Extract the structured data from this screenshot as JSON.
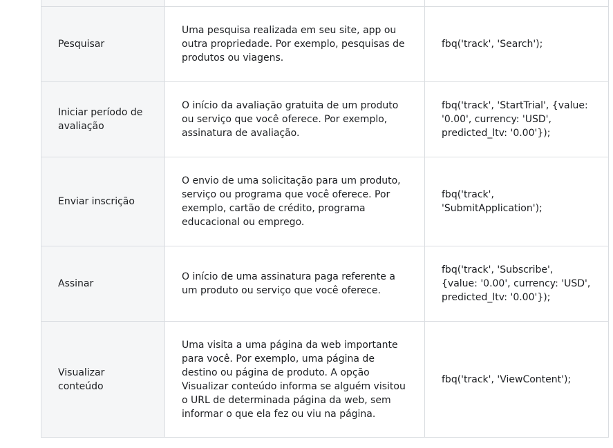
{
  "events": [
    {
      "name": "Pesquisar",
      "description": "Uma pesquisa realizada em seu site, app ou outra propriedade. Por exemplo, pesquisas de produtos ou viagens.",
      "code": "fbq('track', 'Search');"
    },
    {
      "name": "Iniciar período de avaliação",
      "description": "O início da avaliação gratuita de um produto ou serviço que você oferece. Por exemplo, assinatura de avaliação.",
      "code": "fbq('track', 'StartTrial', {value: '0.00', currency: 'USD', predicted_ltv: '0.00'});"
    },
    {
      "name": "Enviar inscrição",
      "description": "O envio de uma solicitação para um produto, serviço ou programa que você oferece. Por exemplo, cartão de crédito, programa educacional ou emprego.",
      "code": "fbq('track', 'SubmitApplication');"
    },
    {
      "name": "Assinar",
      "description": "O início de uma assinatura paga referente a um produto ou serviço que você oferece.",
      "code": "fbq('track', 'Subscribe', {value: '0.00', currency: 'USD', predicted_ltv: '0.00'});"
    },
    {
      "name": "Visualizar conteúdo",
      "description": "Uma visita a uma página da web importante para você. Por exemplo, uma página de destino ou página de produto. A opção Visualizar conteúdo informa se alguém visitou o URL de determinada página da web, sem informar o que ela fez ou viu na página.",
      "code": "fbq('track', 'ViewContent');"
    }
  ]
}
